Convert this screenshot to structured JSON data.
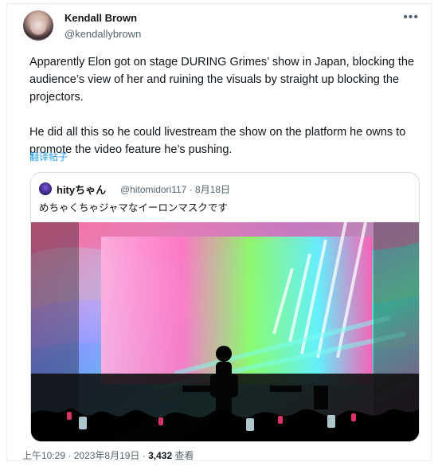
{
  "tweet": {
    "author_name": "Kendall Brown",
    "author_handle": "@kendallybrown",
    "more_icon": "more-horizontal-icon",
    "text": "Apparently Elon got on stage DURING Grimes’ show in Japan, blocking the audience’s view of her and ruining the visuals by straight up blocking the projectors.\n\nHe did all this so he could livestream the show on the platform he owns to promote the video feature he’s pushing.",
    "translate_label": "翻译帖子"
  },
  "quoted_tweet": {
    "author_name": "hityちゃん",
    "author_handle": "@hitomidori117",
    "separator": "·",
    "date": "8月18日",
    "text": "めちゃくちゃジャマなイーロンマスクです"
  },
  "footer": {
    "time": "上午10:29",
    "separator": "·",
    "date": "2023年8月19日",
    "dot": "·",
    "views_count": "3,432",
    "views_label": "查看"
  }
}
